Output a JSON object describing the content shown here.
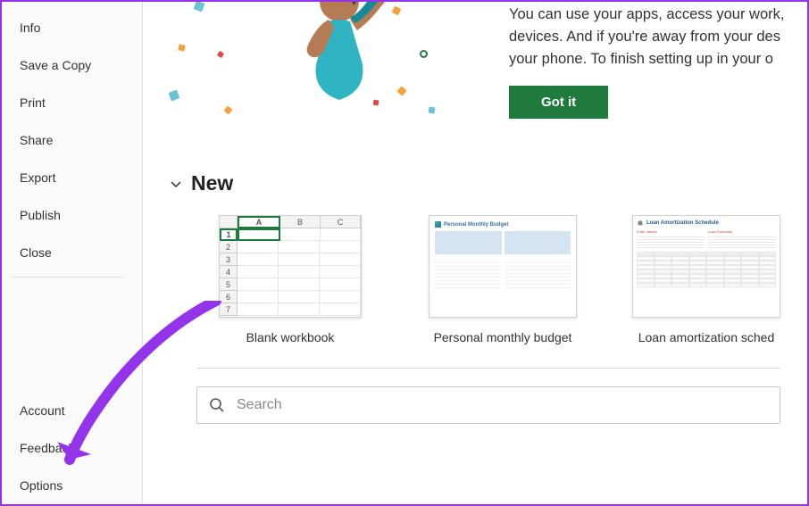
{
  "sidebar": {
    "items": [
      {
        "label": "Info"
      },
      {
        "label": "Save a Copy"
      },
      {
        "label": "Print"
      },
      {
        "label": "Share"
      },
      {
        "label": "Export"
      },
      {
        "label": "Publish"
      },
      {
        "label": "Close"
      }
    ],
    "footer": [
      {
        "label": "Account"
      },
      {
        "label": "Feedback"
      },
      {
        "label": "Options"
      }
    ]
  },
  "banner": {
    "line1": "You can use your apps, access your work,",
    "line2": "devices. And if you're away from your des",
    "line3": "your phone. To finish setting up in your o",
    "button": "Got it"
  },
  "new_section": {
    "title": "New",
    "templates": [
      {
        "label": "Blank workbook"
      },
      {
        "label": "Personal monthly budget"
      },
      {
        "label": "Loan amortization sched"
      }
    ]
  },
  "search": {
    "placeholder": "Search"
  },
  "colors": {
    "accent": "#1f7a3d",
    "arrow": "#9333ea"
  }
}
